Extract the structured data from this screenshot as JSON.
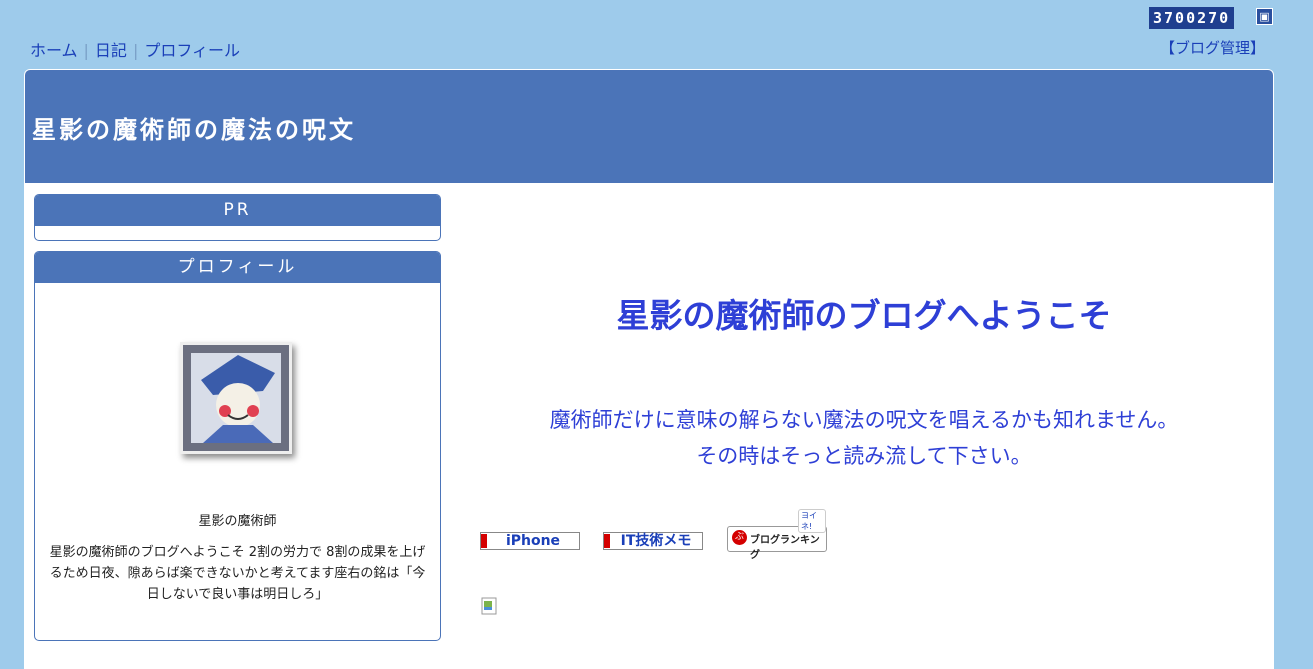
{
  "counter": {
    "value": "3700270"
  },
  "topnav": {
    "home": "ホーム",
    "diary": "日記",
    "profile": "プロフィール",
    "separator": "|"
  },
  "admin": {
    "label": "【ブログ管理】"
  },
  "header": {
    "title": "星影の魔術師の魔法の呪文"
  },
  "sidebar": {
    "pr_title": "PR",
    "profile_title": "プロフィール",
    "profile_name": "星影の魔術師",
    "profile_desc": "星影の魔術師のブログへようこそ 2割の労力で 8割の成果を上げるため日夜、隙あらば楽できないかと考えてます座右の銘は「今日しないで良い事は明日しろ」"
  },
  "main": {
    "welcome": "星影の魔術師のブログへようこそ",
    "intro_line1": "魔術師だけに意味の解らない魔法の呪文を唱えるかも知れません。",
    "intro_line2": "その時はそっと読み流して下さい。",
    "badge_iphone": "iPhone",
    "badge_it": "IT技術メモ",
    "ranking_tag": "ヨイネ!",
    "ranking_label": "ブログランキング"
  },
  "colors": {
    "background": "#9ecbeb",
    "header": "#4b74b8",
    "accent_text": "#2e3fd6",
    "link": "#1a3fb8"
  }
}
